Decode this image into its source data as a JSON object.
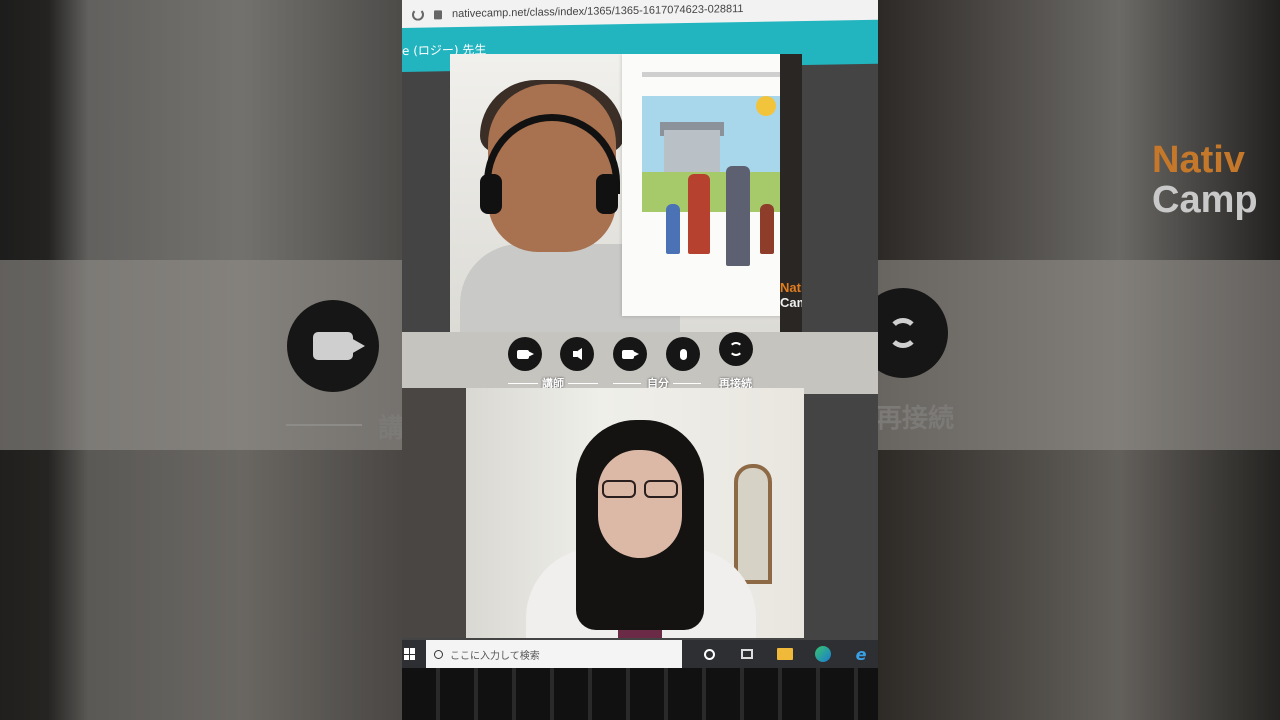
{
  "browser": {
    "url": "nativecamp.net/class/index/1365/1365-1617074623-028811"
  },
  "lesson_header": {
    "teacher_title": "e (ロジー) 先生"
  },
  "controls": {
    "tutor_label": "講師",
    "self_label": "自分",
    "reconnect_label": "再接続"
  },
  "taskbar": {
    "search_placeholder": "ここに入力して検索"
  },
  "background": {
    "ghost_label_left": "講",
    "ghost_label_right": "再接続",
    "logo_line1": "Nativ",
    "logo_line2": "Camp",
    "side_logo_line1": "Nativ",
    "side_logo_line2": "Camp"
  },
  "colors": {
    "header_teal": "#22b4bf",
    "logo_orange": "#c6782a"
  }
}
